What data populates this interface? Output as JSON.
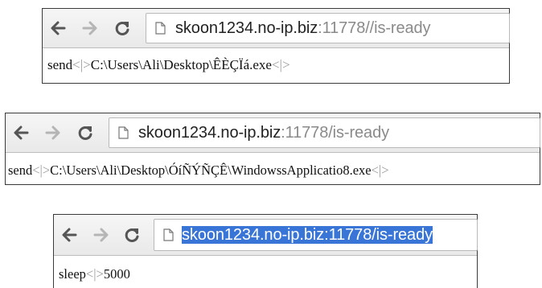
{
  "windows": [
    {
      "address_host": "skoon1234.no-ip.biz",
      "address_path": ":11778//is-ready",
      "address_selected": false,
      "response_command": "send",
      "response_separator": "<|>",
      "response_payload": "C:\\Users\\Ali\\Desktop\\ÊÈÇÏá.exe",
      "response_trailer": "<|>"
    },
    {
      "address_host": "skoon1234.no-ip.biz",
      "address_path": ":11778/is-ready",
      "address_selected": false,
      "response_command": "send",
      "response_separator": "<|>",
      "response_payload": "C:\\Users\\Ali\\Desktop\\ÓíÑÝÑÇÊ\\WindowssApplicatio8.exe",
      "response_trailer": "<|>"
    },
    {
      "address_host": "skoon1234.no-ip.biz",
      "address_path": ":11778/is-ready",
      "address_selected": true,
      "response_command": "sleep",
      "response_separator": "<|>",
      "response_payload": "5000",
      "response_trailer": ""
    }
  ],
  "icons": {
    "back": "back-arrow-icon",
    "forward": "forward-arrow-icon",
    "reload": "reload-icon",
    "page": "page-icon"
  },
  "colors": {
    "selection": "#3875d7",
    "url_path": "#8a8a8a",
    "separator": "#9a9a9a"
  }
}
